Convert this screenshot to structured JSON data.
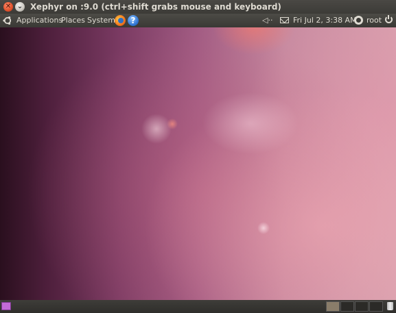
{
  "window": {
    "title": "Xephyr on :9.0 (ctrl+shift grabs mouse and keyboard)",
    "close_icon": "close-icon",
    "minimize_icon": "minimize-icon"
  },
  "top_panel": {
    "menus": [
      {
        "label": "Applications"
      },
      {
        "label": "Places"
      },
      {
        "label": "System"
      }
    ],
    "launchers": [
      "firefox-icon",
      "help-icon"
    ],
    "help_glyph": "?",
    "indicators": {
      "volume_icon": "volume-icon",
      "volume_glyph": "◁··",
      "mail_icon": "mail-icon",
      "clock": "Fri Jul  2,  3:38 AM",
      "user_icon": "user-icon",
      "user": "root",
      "power_icon": "power-icon"
    }
  },
  "desktop": {
    "wallpaper": "ubuntu-karmic-purple",
    "colors": {
      "panel": "#3c3b37",
      "panel_text": "#dfdbd2",
      "wallpaper_dark": "#2a0f1e",
      "wallpaper_light": "#d8a0ae"
    }
  },
  "bottom_panel": {
    "show_desktop_icon": "show-desktop-icon",
    "workspaces": [
      "workspace-1",
      "workspace-2",
      "workspace-3",
      "workspace-4"
    ],
    "active_workspace": 1,
    "trash_icon": "trash-icon"
  }
}
